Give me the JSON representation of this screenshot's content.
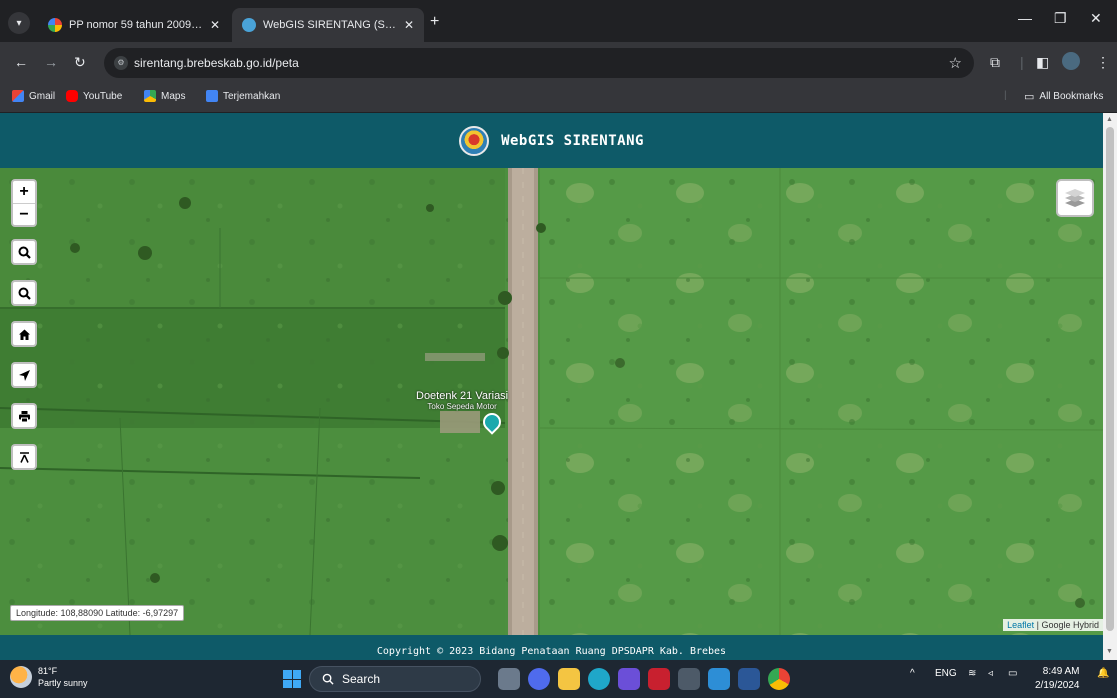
{
  "browser": {
    "tabs": [
      {
        "title": "PP nomor 59 tahun 2009 tentar",
        "active": false
      },
      {
        "title": "WebGIS SIRENTANG (Sistem Inf",
        "active": true
      }
    ],
    "url": "sirentang.brebeskab.go.id/peta",
    "bookmarks": [
      "Gmail",
      "YouTube",
      "Maps",
      "Terjemahkan"
    ],
    "all_bookmarks": "All Bookmarks"
  },
  "app": {
    "title": "WebGIS SIRENTANG",
    "footer": "Copyright © 2023 Bidang Penataan Ruang DPSDAPR Kab. Brebes"
  },
  "map": {
    "zoom_in": "+",
    "zoom_out": "−",
    "coords": "Longitude: 108,88090 Latitude: -6,97297",
    "attribution_link": "Leaflet",
    "attribution_rest": " | Google Hybrid",
    "poi_name": "Doetenk 21 Variasi",
    "poi_type": "Toko Sepeda Motor"
  },
  "taskbar": {
    "temp": "81°F",
    "condition": "Partly sunny",
    "search_label": "Search",
    "lang": "ENG",
    "time": "8:49 AM",
    "date": "2/19/2024"
  }
}
